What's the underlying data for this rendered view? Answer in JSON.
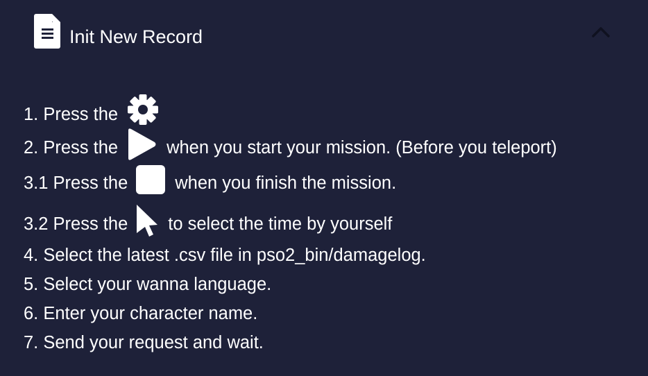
{
  "header": {
    "icon": "document-icon",
    "title": "Init New Record",
    "toggle_icon": "chevron-up-icon"
  },
  "steps": [
    {
      "before": "1. Press the",
      "icon": "gear-icon",
      "after": ""
    },
    {
      "before": "2. Press the",
      "icon": "play-icon",
      "after": "when you start your mission. (Before you teleport)"
    },
    {
      "before": "3.1 Press the",
      "icon": "stop-icon",
      "after": "when you finish the mission."
    },
    {
      "before": "3.2 Press the",
      "icon": "cursor-icon",
      "after": "to select the time by yourself"
    },
    {
      "before": "4. Select the latest .csv file in pso2_bin/damagelog.",
      "icon": "",
      "after": ""
    },
    {
      "before": "5. Select your wanna language.",
      "icon": "",
      "after": ""
    },
    {
      "before": "6. Enter your character name.",
      "icon": "",
      "after": ""
    },
    {
      "before": "7. Send your request and wait.",
      "icon": "",
      "after": ""
    }
  ],
  "colors": {
    "background": "#1e2139",
    "text": "#ffffff",
    "chevron": "#0f1120"
  }
}
